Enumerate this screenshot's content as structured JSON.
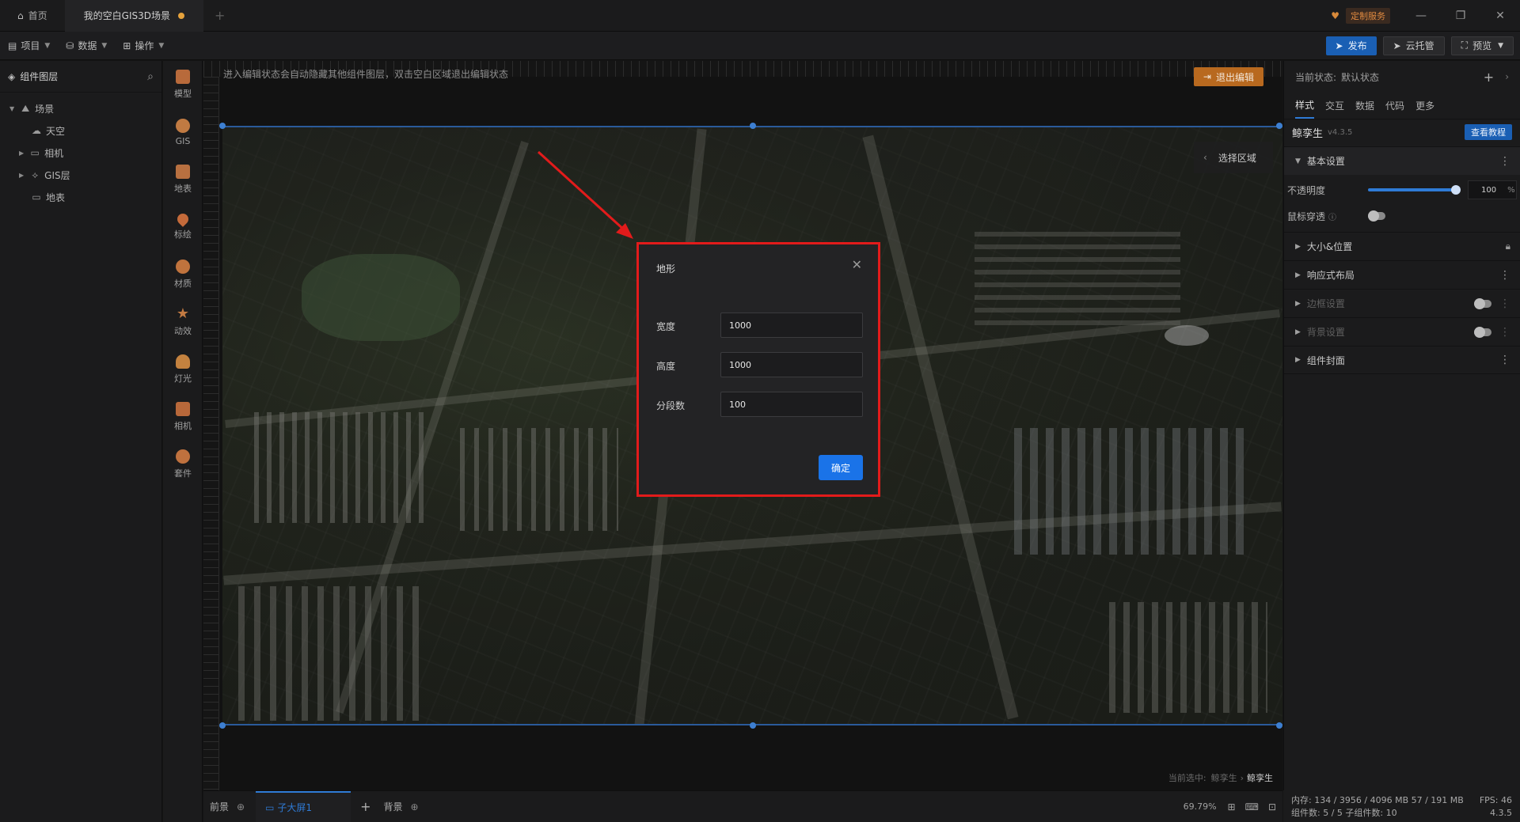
{
  "titlebar": {
    "home_tab": "首页",
    "project_tab": "我的空白GIS3D场景",
    "new_tab_symbol": "+",
    "custom_service": "定制服务",
    "minimize_symbol": "—",
    "restore_symbol": "❐",
    "close_symbol": "✕"
  },
  "toolbar": {
    "menus": [
      "项目",
      "数据",
      "操作"
    ],
    "publish": "发布",
    "cloud_host": "云托管",
    "preview": "预览"
  },
  "left_panel": {
    "title": "组件图层",
    "tree": [
      {
        "label": "场景",
        "icon": "scene-icon"
      },
      {
        "label": "天空",
        "icon": "cloud-icon"
      },
      {
        "label": "相机",
        "icon": "folder-icon"
      },
      {
        "label": "GIS层",
        "icon": "layers-icon"
      },
      {
        "label": "地表",
        "icon": "folder-icon"
      }
    ]
  },
  "strip": {
    "items": [
      {
        "label": "模型",
        "color": "#b86a3b"
      },
      {
        "label": "GIS",
        "color": "#c07a42"
      },
      {
        "label": "地表",
        "color": "#b87040"
      },
      {
        "label": "标绘",
        "color": "#c46a3a"
      },
      {
        "label": "材质",
        "color": "#c0733d"
      },
      {
        "label": "动效",
        "color": "#c27a42"
      },
      {
        "label": "灯光",
        "color": "#c4823f"
      },
      {
        "label": "相机",
        "color": "#b8683a"
      },
      {
        "label": "套件",
        "color": "#bf713e"
      }
    ]
  },
  "canvas": {
    "hint": "进入编辑状态会自动隐藏其他组件图层，双击空白区域退出编辑状态",
    "exit_edit": "退出编辑",
    "select_area": "选择区域",
    "selected_path_prefix": "当前选中:",
    "selected_path_parent": "鲸孪生",
    "selected_path_current": "鲸孪生"
  },
  "dialog": {
    "title": "地形",
    "fields": [
      {
        "label": "宽度",
        "value": "1000"
      },
      {
        "label": "高度",
        "value": "1000"
      },
      {
        "label": "分段数",
        "value": "100"
      }
    ],
    "confirm": "确定",
    "highlight_color": "#e21b1b"
  },
  "right_panel": {
    "state_label": "当前状态:",
    "state_value": "默认状态",
    "tabs": [
      "样式",
      "交互",
      "数据",
      "代码",
      "更多"
    ],
    "component_name": "鲸孪生",
    "version": "v4.3.5",
    "tutorial": "查看教程",
    "sections": {
      "basic": "基本设置",
      "opacity_label": "不透明度",
      "opacity_value": "100",
      "opacity_unit": "%",
      "mouse_through": "鼠标穿透",
      "size_pos": "大小&位置",
      "responsive": "响应式布局",
      "border": "边框设置",
      "background": "背景设置",
      "cover": "组件封面"
    }
  },
  "bottom": {
    "foreground": "前景",
    "subscreen": "子大屏1",
    "background": "背景",
    "zoom": "69.79%"
  },
  "status": {
    "memory": "内存:  134 / 3956 / 4096 MB   57 / 191 MB",
    "fps": "FPS:   46",
    "components": "组件数: 5 / 5    子组件数: 10",
    "version": "4.3.5"
  },
  "colors": {
    "accent": "#1a73e8",
    "warning": "#b8691f",
    "dialog_bg": "#232325"
  }
}
